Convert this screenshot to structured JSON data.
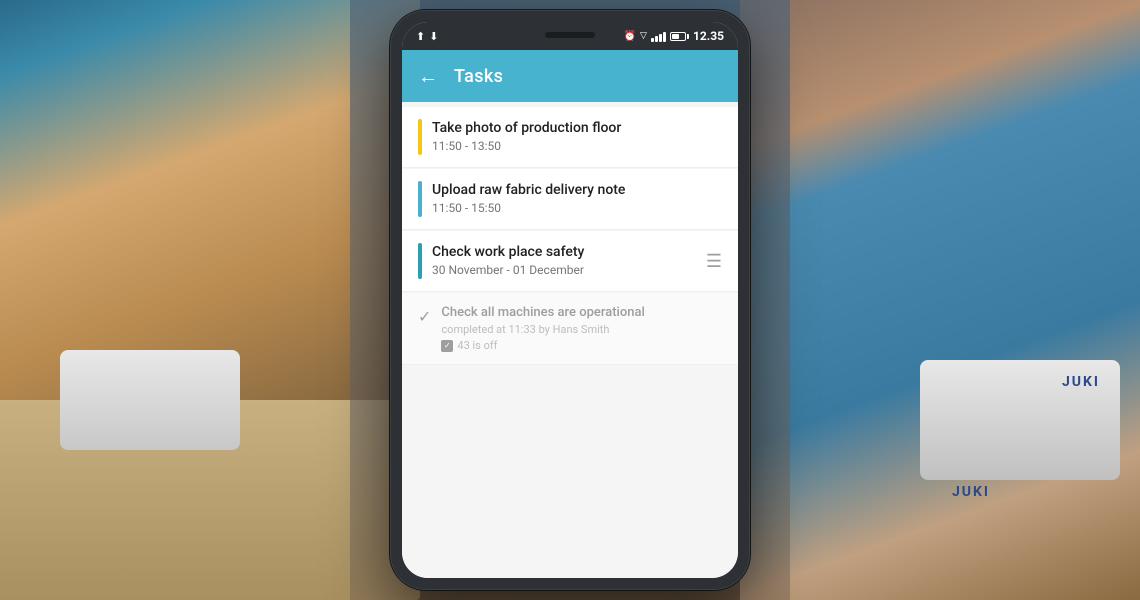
{
  "background": {
    "description": "Factory floor with sewing machines"
  },
  "phone": {
    "status_bar": {
      "time": "12.35",
      "icons_left": [
        "upload-icon",
        "copy-icon"
      ],
      "icons_right": [
        "alarm-icon",
        "wifi-icon",
        "signal-icon",
        "battery-icon"
      ]
    },
    "app_bar": {
      "back_label": "←",
      "title": "Tasks"
    },
    "tasks": [
      {
        "id": "task-1",
        "bar_color": "yellow",
        "title": "Take photo of production floor",
        "time": "11:50 - 13:50",
        "has_icon": false,
        "completed": false
      },
      {
        "id": "task-2",
        "bar_color": "blue",
        "title": "Upload raw fabric delivery note",
        "time": "11:50 - 15:50",
        "has_icon": false,
        "completed": false
      },
      {
        "id": "task-3",
        "bar_color": "teal",
        "title": "Check work place safety",
        "time": "30 November - 01 December",
        "has_icon": true,
        "completed": false
      },
      {
        "id": "task-4",
        "bar_color": "none",
        "title": "Check all machines are operational",
        "completed": true,
        "completed_by": "completed at 11:33 by Hans Smith",
        "checkbox_label": "43 is off",
        "checkbox_checked": true
      }
    ]
  }
}
